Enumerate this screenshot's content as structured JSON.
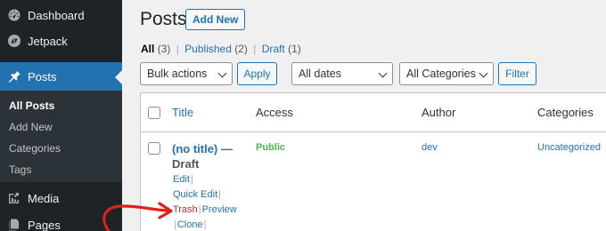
{
  "sidebar": {
    "items": [
      {
        "label": "Dashboard",
        "icon": "dashboard-icon"
      },
      {
        "label": "Jetpack",
        "icon": "jetpack-icon"
      },
      {
        "label": "Posts",
        "icon": "pin-icon"
      },
      {
        "label": "Media",
        "icon": "media-icon"
      },
      {
        "label": "Pages",
        "icon": "pages-icon"
      }
    ],
    "submenu": [
      "All Posts",
      "Add New",
      "Categories",
      "Tags"
    ]
  },
  "header": {
    "title": "Posts",
    "add_new_label": "Add New"
  },
  "views": [
    {
      "label": "All",
      "count": "(3)"
    },
    {
      "label": "Published",
      "count": "(2)"
    },
    {
      "label": "Draft",
      "count": "(1)"
    }
  ],
  "views_separator": "|",
  "filters": {
    "bulk_actions": "Bulk actions",
    "apply_label": "Apply",
    "dates": "All dates",
    "categories": "All Categories",
    "filter_label": "Filter"
  },
  "table": {
    "columns": [
      "Title",
      "Access",
      "Author",
      "Categories"
    ],
    "row": {
      "title": "(no title)",
      "state": "— Draft",
      "access": "Public",
      "author": "dev",
      "categories": "Uncategorized",
      "actions": [
        "Edit",
        "Quick Edit",
        "Trash",
        "Preview",
        "Clone"
      ]
    }
  },
  "colors": {
    "sidebar_bg": "#1d2327",
    "accent": "#2271b1",
    "trash": "#b32d2e",
    "public": "#46b450",
    "annotation_arrow": "#e0201a"
  }
}
